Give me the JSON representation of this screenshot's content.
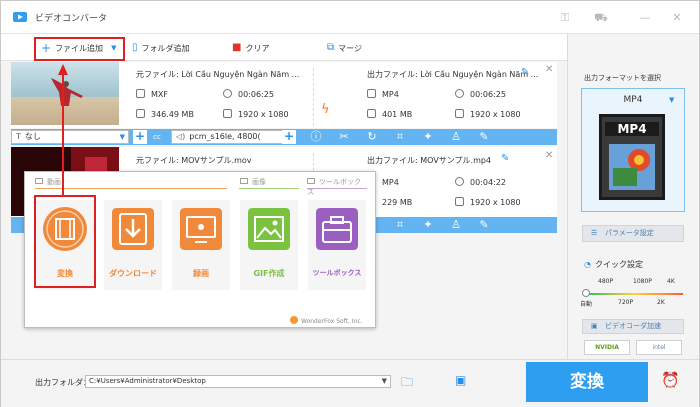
{
  "app": {
    "title": "ビデオコンバータ",
    "accent": "#2e9ff0"
  },
  "toolbar": {
    "add_file": "ファイル追加",
    "add_folder": "フォルダ追加",
    "clear": "クリア",
    "merge": "マージ"
  },
  "files": [
    {
      "source_label": "元ファイル: Lời Cầu Nguyện Ngàn Năm ...",
      "source_format": "MXF",
      "source_duration": "00:06:25",
      "source_size": "346.49 MB",
      "source_resolution": "1920 x 1080",
      "output_label": "出力ファイル: Lời Cầu Nguyện Ngàn Năm ...",
      "output_format": "MP4",
      "output_duration": "00:06:25",
      "output_size": "401 MB",
      "output_resolution": "1920 x 1080"
    },
    {
      "source_label": "元ファイル: MOVサンプル.mov",
      "output_label": "出力ファイル: MOVサンプル.mp4",
      "output_format": "MP4",
      "output_duration": "00:04:22",
      "output_size": "229 MB",
      "output_resolution": "1920 x 1080"
    }
  ],
  "editbar": {
    "subtitle_value": "なし",
    "audio_value": "pcm_s16le, 4800("
  },
  "popup": {
    "tabs": [
      "動画",
      "画像",
      "ツールボックス"
    ],
    "tiles": [
      {
        "label": "変換",
        "color": "#f08a3a"
      },
      {
        "label": "ダウンロード",
        "color": "#f08a3a"
      },
      {
        "label": "録画",
        "color": "#f08a3a"
      },
      {
        "label": "GIF作成",
        "color": "#7cc241"
      },
      {
        "label": "ツールボックス",
        "color": "#9b5fc0"
      }
    ],
    "footer": "WonderFox Soft, Inc."
  },
  "right_panel": {
    "title": "出力フォーマットを選択",
    "format": "MP4",
    "param_button": "パラメータ設定",
    "quick_setting": "クイック設定",
    "ticks_top": [
      "480P",
      "1080P",
      "4K"
    ],
    "ticks_bottom": [
      "自動",
      "720P",
      "2K"
    ],
    "gpu_button": "ビデオコーダ加速",
    "hw": [
      "NVIDIA",
      "intel"
    ]
  },
  "bottom": {
    "output_folder_label": "出力フォルダ：",
    "output_path": "C:¥Users¥Administrator¥Desktop",
    "convert_button": "変換"
  }
}
